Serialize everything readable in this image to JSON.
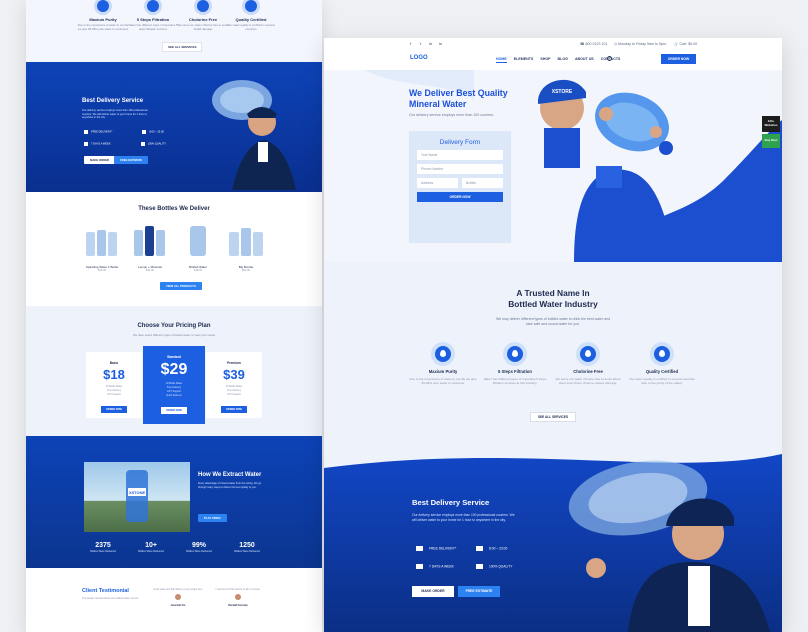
{
  "left": {
    "features": [
      {
        "title": "Maxium Purity",
        "desc": "Due to the importance of water to our life we give 99.99% pure water to customers"
      },
      {
        "title": "5 Steps Filtration",
        "desc": "Water has different types of impurities 5 steps filtration services"
      },
      {
        "title": "Cholorine Free",
        "desc": "We serve our water chlorine free to avoid health damage"
      },
      {
        "title": "Quality Certified",
        "desc": "Our water quality is certified in several countries"
      }
    ],
    "see_all": "SEE ALL SERVICES",
    "delivery": {
      "title": "Best Delivery Service",
      "text": "Our delivery service employs more than 100 professional couriers. We will deliver water to your home for 1 hour to anywhere in the city.",
      "items": [
        "FREE DELIVERY*",
        "8:00 – 23:00",
        "7 DAYS A WEEK",
        "100% QUALITY"
      ],
      "btn1": "MAKE ORDER",
      "btn2": "FREE ESTIMATE"
    },
    "bottles": {
      "title": "These Bottles We Deliver",
      "items": [
        {
          "name": "Sparkling Water 1 Bottle",
          "price": "$20.00"
        },
        {
          "name": "Lemon + Minerals",
          "price": "$24.00"
        },
        {
          "name": "Bottled Water",
          "price": "$18.00"
        },
        {
          "name": "Big Bundle",
          "price": "$44.00"
        }
      ],
      "view_btn": "VIEW ALL PRODUCTS"
    },
    "pricing": {
      "title": "Choose Your Pricing Plan",
      "sub": "We have select different types of bottled water to meet your needs",
      "plans": [
        {
          "name": "Basic",
          "price": "$18",
          "lines": [
            "19 Bottle Water",
            "Free Delivery",
            "24/7 Support"
          ],
          "btn": "ORDER NOW"
        },
        {
          "name": "Standard",
          "price": "$29",
          "lines": [
            "19 Bottle Water",
            "Free Delivery",
            "24/7 Support",
            "Quick Delivery"
          ],
          "btn": "ORDER NOW"
        },
        {
          "name": "Premium",
          "price": "$39",
          "lines": [
            "19 Bottle Water",
            "Free Delivery",
            "24/7 Support"
          ],
          "btn": "ORDER NOW"
        }
      ]
    },
    "extract": {
      "title": "How We Extract Water",
      "text": "Every advantage of mineral water from the spring. We go through many steps to deliver the best quality to you.",
      "btn": "PLAY VIDEO",
      "bottle_label": "XSTONE"
    },
    "stats": [
      {
        "value": "2375",
        "label": "Bottles Were Delivered"
      },
      {
        "value": "10+",
        "label": "Bottles Were Delivered"
      },
      {
        "value": "99%",
        "label": "Bottles Were Delivered"
      },
      {
        "value": "1250",
        "label": "Bottles Were Delivered"
      }
    ],
    "testimonial": {
      "title": "Client Testimonial",
      "text": "Our people reviews about our bottled water service.",
      "quotes": [
        {
          "text": "Great water and fast delivery every single time.",
          "who": "Jeremiah Fin"
        },
        {
          "text": "I recommend this service to all my friends.",
          "who": "Randall Kennedy"
        }
      ]
    }
  },
  "right": {
    "topbar": {
      "social": [
        "f",
        "t",
        "in",
        "in"
      ],
      "phone": "800 0123 101",
      "hours": "Monday to Friday 9am to 5pm",
      "cart": "Cart: $0.00"
    },
    "logo": "LOGO",
    "menu": [
      "HOME",
      "ELEMENTS",
      "SHOP",
      "BLOG",
      "ABOUT US",
      "CONTACTS"
    ],
    "order_btn": "ORDER NOW",
    "hero": {
      "title": "We Deliver Best Quality Mineral Water",
      "sub": "Our delivery service employs more than 100 couriers.",
      "cap_text": "XSTORE"
    },
    "form": {
      "title": "Delivery Form",
      "name_ph": "Your Name",
      "phone_ph": "Phone Number",
      "address_ph": "Address",
      "bottles_ph": "Bottles",
      "submit": "ORDER NOW"
    },
    "side_tabs": [
      {
        "label": "130+ Websites"
      },
      {
        "label": "Buy Now"
      }
    ],
    "trusted": {
      "title": "A Trusted Name In\nBottled Water Industry",
      "p": "We may deliver different types of bottled water to drink the best water and take safe and sound water for you.",
      "features": [
        {
          "title": "Maxium Purity",
          "desc": "Due to the importance of water to our life we give 99.99% pure water to customer"
        },
        {
          "title": "5 Steps Filtration",
          "desc": "Water has different types of impurities 5 steps filtration services at this industry."
        },
        {
          "title": "Cholorine Free",
          "desc": "We serve our water chlorine free to avoid about client look phone chlorine causes damage."
        },
        {
          "title": "Quality Certified",
          "desc": "Our water quality is certified in several countries (due to the purity of the water)."
        }
      ],
      "see_all": "SEE ALL SERVICES"
    },
    "delivery": {
      "title": "Best Delivery Service",
      "text": "Our delivery service employs more than 100 professional couriers. We will deliver water to your home for 1 hour to anywhere in the city.",
      "items": [
        "FREE DELIVERY*",
        "8:00 – 23:00",
        "7 DAYS A WEEK",
        "100% QUALITY"
      ],
      "btn1": "MAKE ORDER",
      "btn2": "FREE ESTIMATE"
    }
  }
}
